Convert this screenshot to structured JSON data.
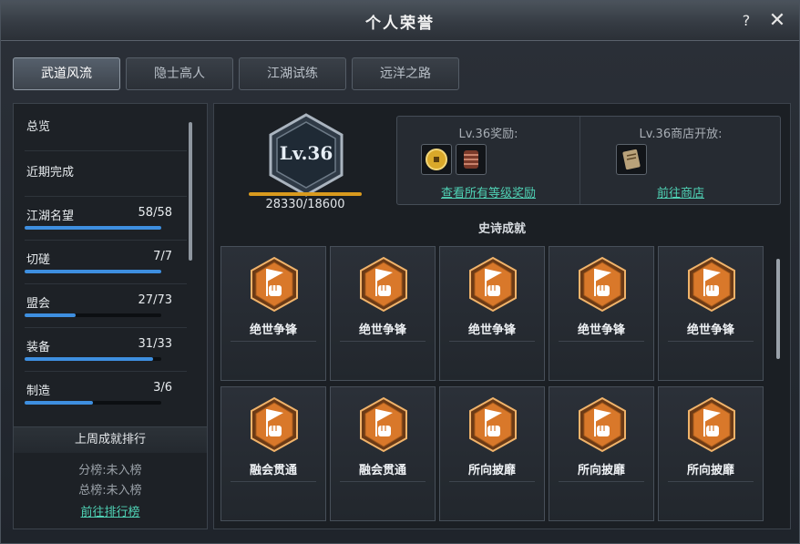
{
  "window": {
    "title": "个人荣誉",
    "help": "?",
    "close": "✕"
  },
  "tabs": [
    {
      "label": "武道风流",
      "active": true
    },
    {
      "label": "隐士高人",
      "active": false
    },
    {
      "label": "江湖试练",
      "active": false
    },
    {
      "label": "远洋之路",
      "active": false
    }
  ],
  "nav": [
    {
      "label": "总览"
    },
    {
      "label": "近期完成"
    },
    {
      "label": "江湖名望",
      "count": "58/58",
      "progress": 1.0
    },
    {
      "label": "切磋",
      "count": "7/7",
      "progress": 1.0
    },
    {
      "label": "盟会",
      "count": "27/73",
      "progress": 0.37
    },
    {
      "label": "装备",
      "count": "31/33",
      "progress": 0.94
    },
    {
      "label": "制造",
      "count": "3/6",
      "progress": 0.5
    }
  ],
  "ranking": {
    "header": "上周成就排行",
    "branch": "分榜:未入榜",
    "total": "总榜:未入榜",
    "link": "前往排行榜"
  },
  "level": {
    "label": "Lv.36",
    "xp": "28330/18600",
    "xp_progress": 1.0
  },
  "rewards": {
    "title": "Lv.36奖励:",
    "link": "查看所有等级奖励",
    "items": [
      "gold-coin-icon",
      "armor-bracer-icon"
    ]
  },
  "shop": {
    "title": "Lv.36商店开放:",
    "link": "前往商店",
    "items": [
      "scroll-book-icon"
    ]
  },
  "achievements": {
    "title": "史诗成就",
    "cards": [
      {
        "label": "绝世争锋"
      },
      {
        "label": "绝世争锋"
      },
      {
        "label": "绝世争锋"
      },
      {
        "label": "绝世争锋"
      },
      {
        "label": "绝世争锋"
      },
      {
        "label": "融会贯通"
      },
      {
        "label": "融会贯通"
      },
      {
        "label": "所向披靡"
      },
      {
        "label": "所向披靡"
      },
      {
        "label": "所向披靡"
      }
    ]
  },
  "colors": {
    "accent_link": "#4fd1b4",
    "progress_blue": "#3e8fe0",
    "xp_gold": "#d99a1e",
    "badge_orange": "#d9782a"
  }
}
